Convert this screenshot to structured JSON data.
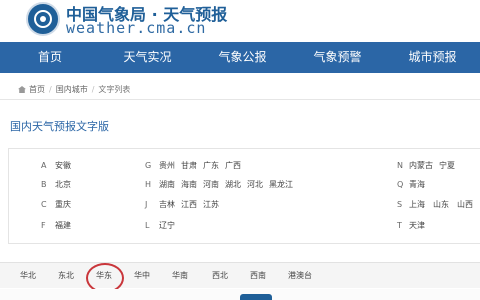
{
  "header": {
    "site_name": "中国气象局 · 天气预报",
    "site_url": "weather.cma.cn"
  },
  "nav": {
    "items": [
      "首页",
      "天气实况",
      "气象公报",
      "气象预警",
      "城市预报"
    ]
  },
  "breadcrumb": {
    "home": "首页",
    "level1": "国内城市",
    "current": "文字列表"
  },
  "section": {
    "title": "国内天气预报文字版"
  },
  "provinces": {
    "rows": [
      {
        "c1": {
          "letter": "A",
          "items": [
            "安徽"
          ]
        },
        "c2": {
          "letter": "G",
          "items": [
            "贵州",
            "甘肃",
            "广东",
            "广西"
          ]
        },
        "c3": {
          "letter": "N",
          "items": [
            "内蒙古",
            "宁夏"
          ]
        }
      },
      {
        "c1": {
          "letter": "B",
          "items": [
            "北京"
          ]
        },
        "c2": {
          "letter": "H",
          "items": [
            "湖南",
            "海南",
            "河南",
            "湖北",
            "河北",
            "黑龙江"
          ]
        },
        "c3": {
          "letter": "Q",
          "items": [
            "青海"
          ]
        }
      },
      {
        "c1": {
          "letter": "C",
          "items": [
            "重庆"
          ]
        },
        "c2": {
          "letter": "J",
          "items": [
            "吉林",
            "江西",
            "江苏"
          ]
        },
        "c3": {
          "letter": "S",
          "items": [
            "上海",
            "山东",
            "山西"
          ]
        }
      },
      {
        "c1": {
          "letter": "F",
          "items": [
            "福建"
          ]
        },
        "c2": {
          "letter": "L",
          "items": [
            "辽宁"
          ]
        },
        "c3": {
          "letter": "T",
          "items": [
            "天津"
          ]
        }
      }
    ]
  },
  "region_tabs": [
    "华北",
    "东北",
    "华东",
    "华中",
    "华南",
    "西北",
    "西南",
    "港澳台"
  ],
  "colors": {
    "brand": "#2b66a6",
    "highlight_circle": "#c9363b"
  }
}
